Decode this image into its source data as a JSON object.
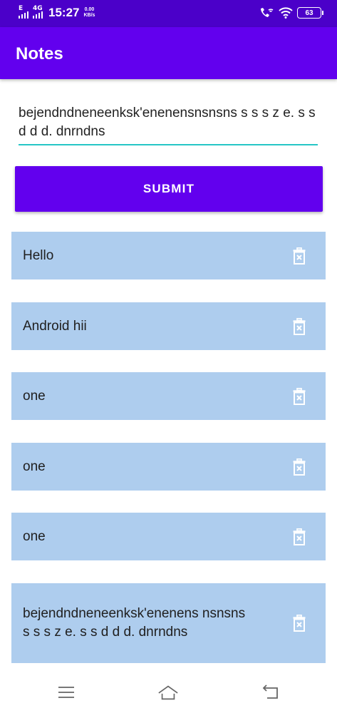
{
  "status_bar": {
    "network_type": "E",
    "network_type_2": "4G",
    "time": "15:27",
    "speed_value": "0.00",
    "speed_unit": "KB/s",
    "battery": "63"
  },
  "app_bar": {
    "title": "Notes"
  },
  "note_input": {
    "value": "bejendndneneenksk'enenensnsnsns s s s z e. s s d d d. dnrndns"
  },
  "submit_button": {
    "label": "SUBMIT"
  },
  "notes": [
    {
      "text": "Hello"
    },
    {
      "text": "Android hii"
    },
    {
      "text": "one"
    },
    {
      "text": "one"
    },
    {
      "text": "one"
    },
    {
      "text": "bejendndneneenksk'enenens nsnsns s s s z e. s s d d d. dnrndns"
    }
  ],
  "icons": {
    "delete": "trash-icon",
    "menu": "menu-icon",
    "home": "home-icon",
    "back": "back-icon"
  },
  "colors": {
    "primary": "#6200ee",
    "status_bar": "#4b00c9",
    "note_background": "#aecdee",
    "input_underline": "#26c6c6"
  }
}
